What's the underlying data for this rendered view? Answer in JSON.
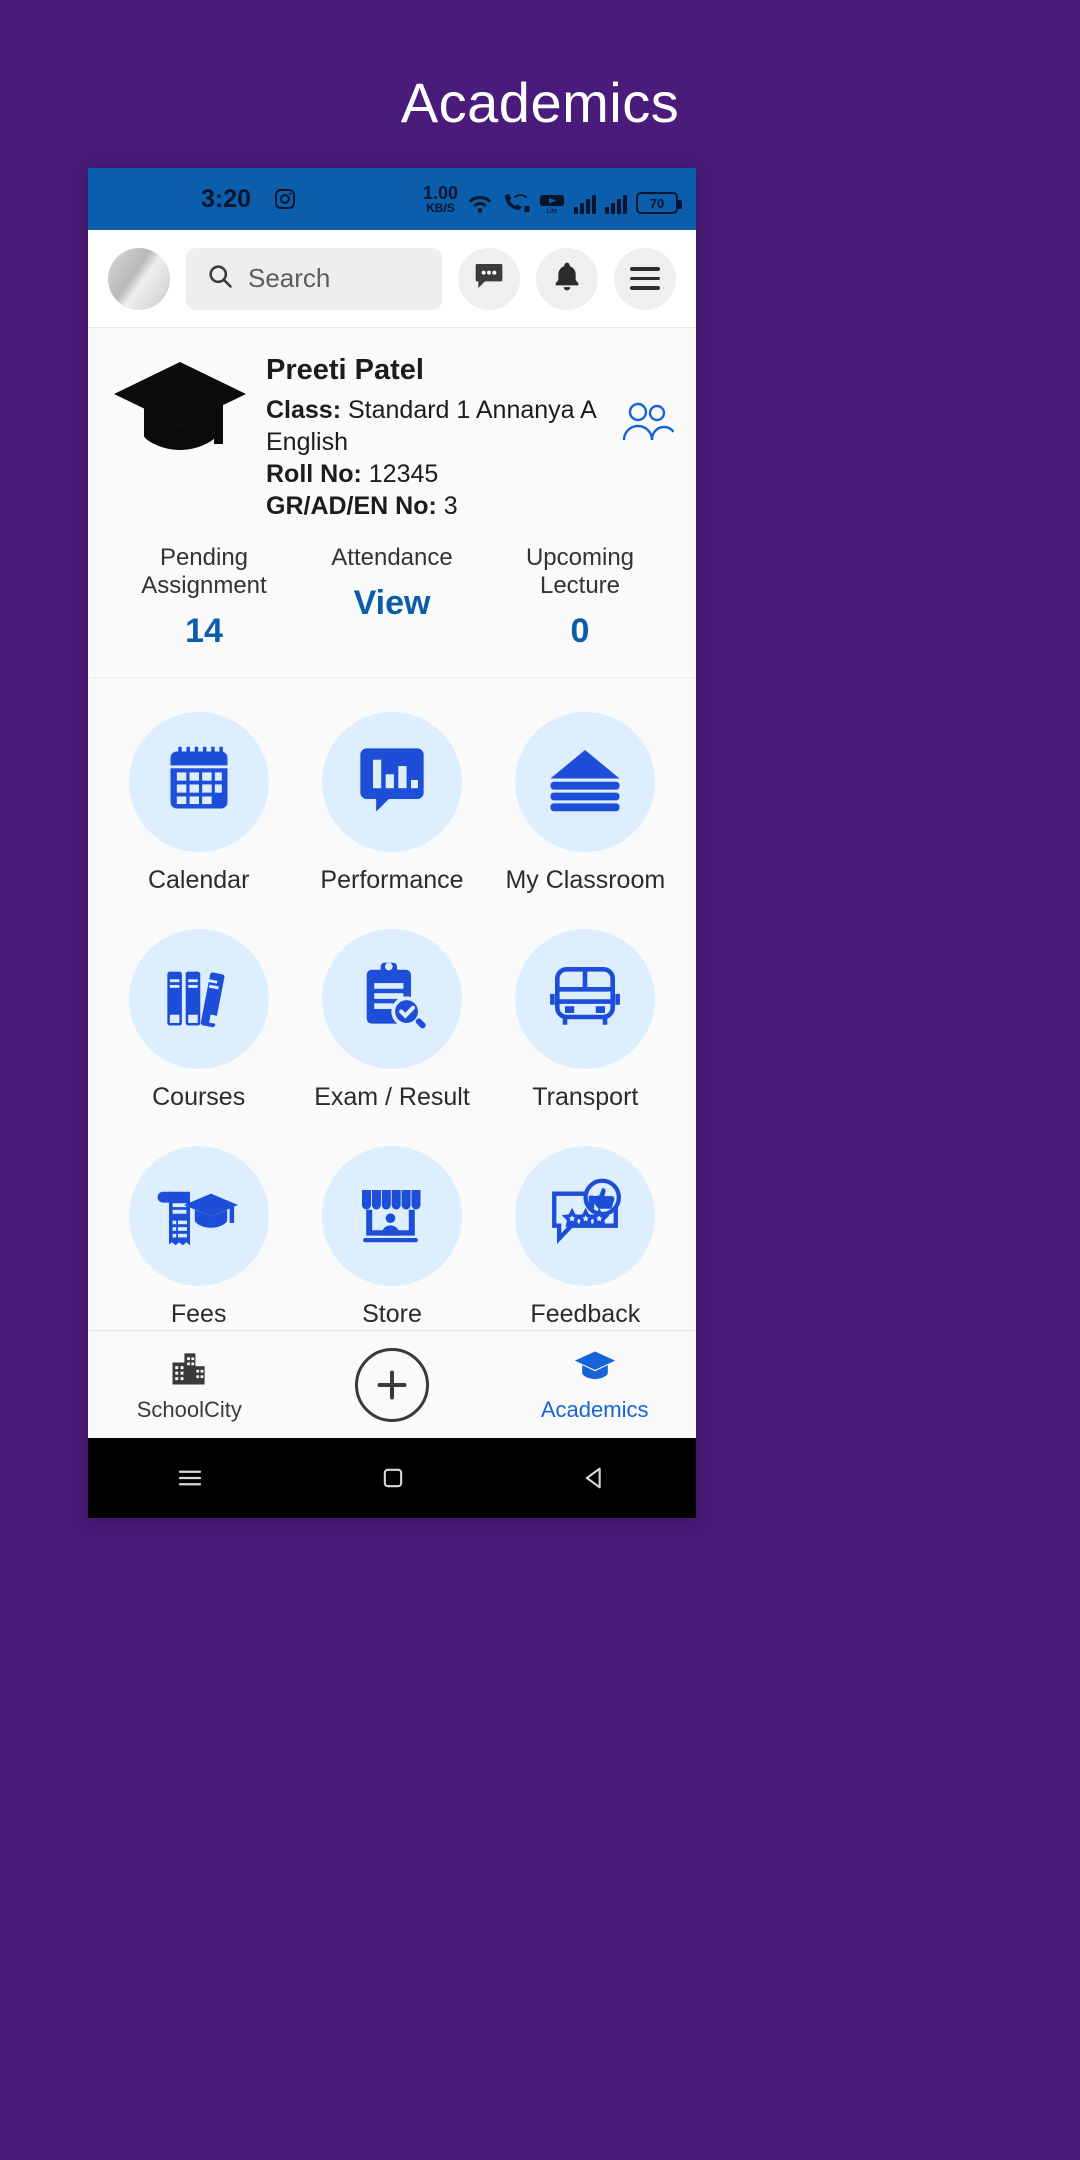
{
  "page": {
    "title": "Academics",
    "bg_color": "#4a1b7a"
  },
  "statusbar": {
    "time": "3:20",
    "app_icon": "instagram-icon",
    "data_rate_value": "1.00",
    "data_rate_unit": "KB/S",
    "icons": [
      "wifi-icon",
      "call-wifi-icon",
      "youtube-lite-icon"
    ],
    "battery_percent": "70",
    "bg_color": "#0a5eab"
  },
  "appbar": {
    "avatar": "user-avatar",
    "search": {
      "placeholder": "Search",
      "value": ""
    },
    "actions": [
      {
        "name": "messages-icon",
        "label": "Messages"
      },
      {
        "name": "notifications-bell-icon",
        "label": "Notifications"
      },
      {
        "name": "menu-hamburger-icon",
        "label": "Menu"
      }
    ]
  },
  "student": {
    "name": "Preeti Patel",
    "class_label": "Class:",
    "class_value": "Standard 1 Annanya A English",
    "roll_label": "Roll No:",
    "roll_value": "12345",
    "gr_label": "GR/AD/EN No:",
    "gr_value": "3",
    "switch_icon": "switch-student-icon"
  },
  "stats": [
    {
      "label": "Pending Assignment",
      "value": "14"
    },
    {
      "label": "Attendance",
      "value": "View"
    },
    {
      "label": "Upcoming Lecture",
      "value": "0"
    }
  ],
  "accent_color": "#0b5cab",
  "tile_icon_color": "#1d4ed8",
  "tile_bubble_color": "#ddeeff",
  "tiles": [
    {
      "label": "Calendar",
      "icon": "calendar-icon"
    },
    {
      "label": "Performance",
      "icon": "performance-chart-bubble-icon"
    },
    {
      "label": "My Classroom",
      "icon": "books-stack-icon"
    },
    {
      "label": "Courses",
      "icon": "book-shelf-icon"
    },
    {
      "label": "Exam / Result",
      "icon": "clipboard-search-icon"
    },
    {
      "label": "Transport",
      "icon": "bus-icon"
    },
    {
      "label": "Fees",
      "icon": "receipt-graduation-icon"
    },
    {
      "label": "Store",
      "icon": "storefront-icon"
    },
    {
      "label": "Feedback",
      "icon": "feedback-thumbsup-icon"
    }
  ],
  "bottomnav": [
    {
      "label": "SchoolCity",
      "icon": "city-buildings-icon",
      "active": false
    },
    {
      "label": "",
      "icon": "plus-circle-icon",
      "active": false
    },
    {
      "label": "Academics",
      "icon": "graduation-cap-icon",
      "active": true
    }
  ],
  "androidnav": [
    "recents-icon",
    "home-icon",
    "back-icon"
  ]
}
